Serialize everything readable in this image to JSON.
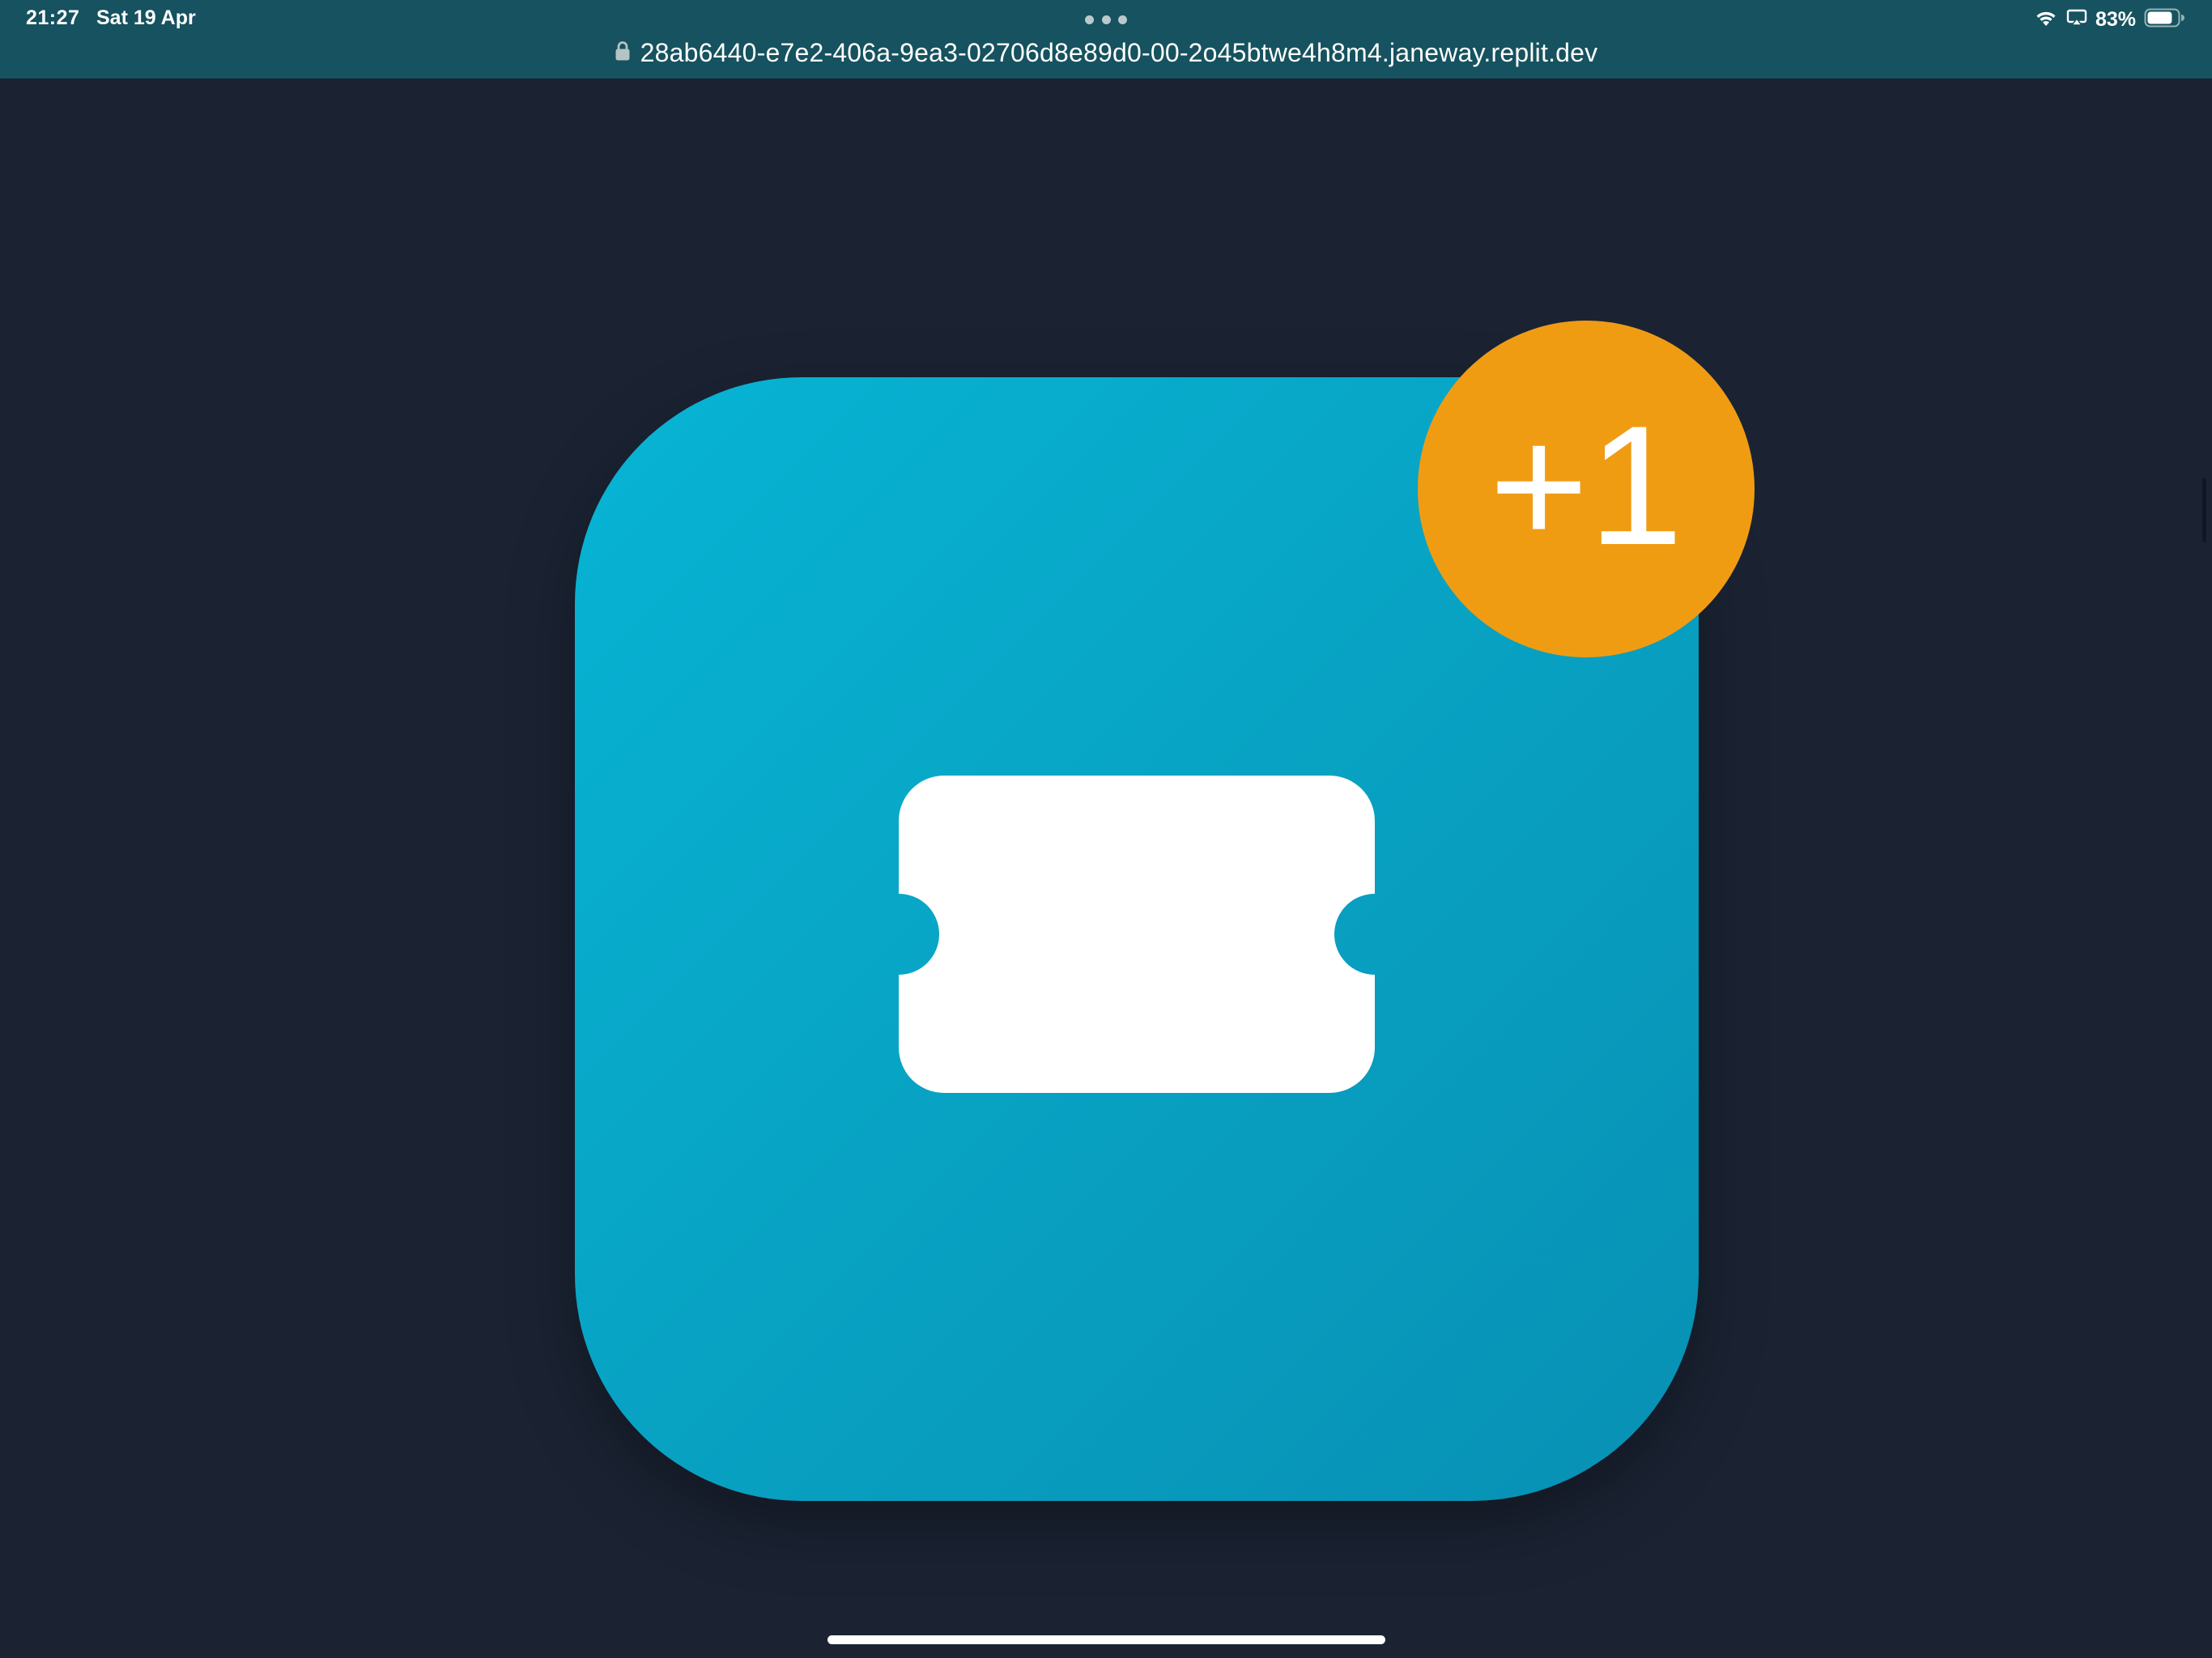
{
  "status_bar": {
    "time": "21:27",
    "date": "Sat 19 Apr",
    "battery_percent": "83%",
    "battery_level": 0.83
  },
  "browser": {
    "url": "28ab6440-e7e2-406a-9ea3-02706d8e89d0-00-2o45btwe4h8m4.janeway.replit.dev"
  },
  "app_icon": {
    "icon": "ticket-icon",
    "badge_label": "+1"
  },
  "colors": {
    "background": "#1b2333",
    "browser_bar": "#16525f",
    "icon_gradient_start": "#07b4d4",
    "icon_gradient_end": "#0790b4",
    "badge": "#f09c13"
  }
}
